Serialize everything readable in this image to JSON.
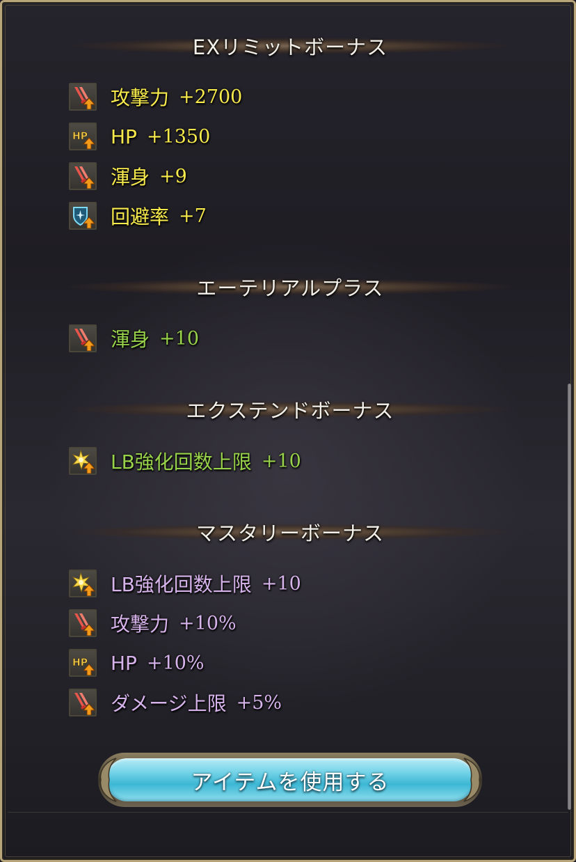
{
  "colors": {
    "yellow": "#f7ea4c",
    "green": "#98d24a",
    "purple": "#d7b3ec"
  },
  "sections": [
    {
      "title": "EXリミットボーナス",
      "color": "yellow",
      "items": [
        {
          "icon": "sword-up-icon",
          "name": "攻撃力",
          "value": "+2700"
        },
        {
          "icon": "hp-up-icon",
          "name": "HP",
          "value": "+1350"
        },
        {
          "icon": "sword-up-icon",
          "name": "渾身",
          "value": "+9"
        },
        {
          "icon": "dodge-up-icon",
          "name": "回避率",
          "value": "+7"
        }
      ]
    },
    {
      "title": "エーテリアルプラス",
      "color": "green",
      "items": [
        {
          "icon": "sword-up-icon",
          "name": "渾身",
          "value": "+10"
        }
      ]
    },
    {
      "title": "エクステンドボーナス",
      "color": "green",
      "items": [
        {
          "icon": "star-up-icon",
          "name": "LB強化回数上限",
          "value": "+10"
        }
      ]
    },
    {
      "title": "マスタリーボーナス",
      "color": "purple",
      "items": [
        {
          "icon": "star-up-icon",
          "name": "LB強化回数上限",
          "value": "+10"
        },
        {
          "icon": "sword-up-icon",
          "name": "攻撃力",
          "value": "+10%"
        },
        {
          "icon": "hp-up-icon",
          "name": "HP",
          "value": "+10%"
        },
        {
          "icon": "sword-up-icon",
          "name": "ダメージ上限",
          "value": "+5%"
        }
      ]
    }
  ],
  "use_button": {
    "label": "アイテムを使用する"
  }
}
